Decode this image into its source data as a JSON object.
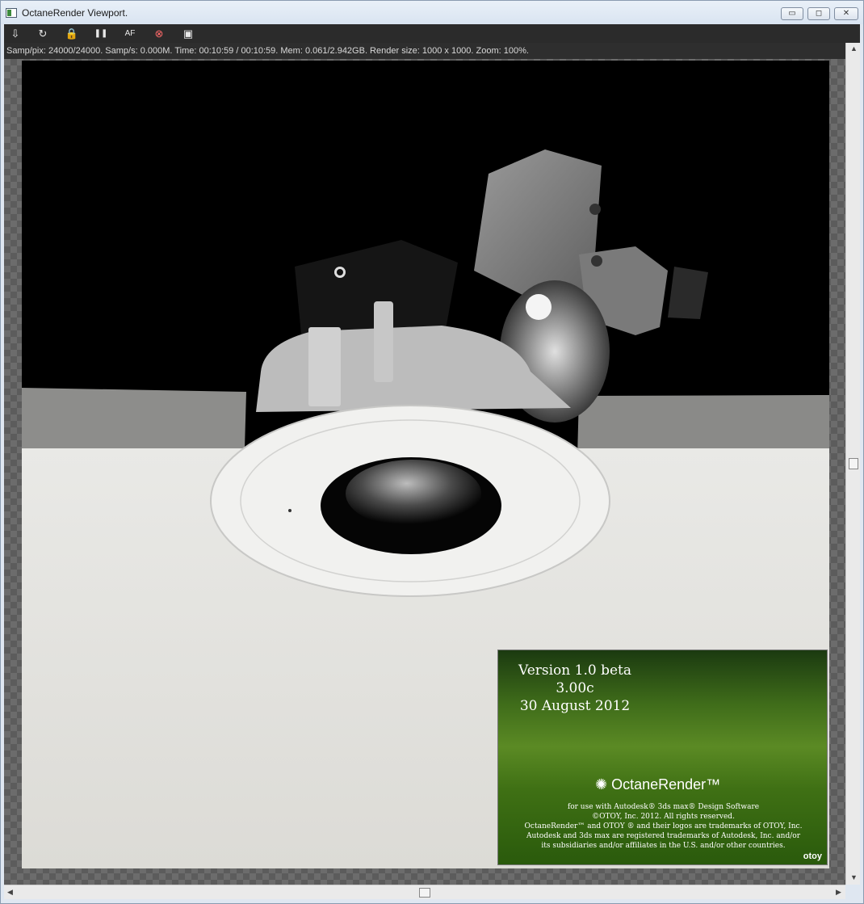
{
  "window": {
    "title": "OctaneRender Viewport.",
    "min_glyph": "▭",
    "max_glyph": "◻",
    "close_glyph": "✕"
  },
  "toolbar": {
    "items": [
      {
        "icon": "save-render-icon",
        "glyph": "⇩"
      },
      {
        "icon": "restart-render-icon",
        "glyph": "↻"
      },
      {
        "icon": "lock-icon",
        "glyph": "🔒"
      },
      {
        "icon": "pause-icon",
        "glyph": "❚❚"
      },
      {
        "icon": "focus-picker-icon",
        "glyph": "AF"
      },
      {
        "icon": "stop-render-icon",
        "glyph": "⊗"
      },
      {
        "icon": "display-icon",
        "glyph": "▣"
      }
    ]
  },
  "status": {
    "text": "Samp/pix: 24000/24000.   Samp/s: 0.000M.   Time: 00:10:59 / 00:10:59.   Mem: 0.061/2.942GB.   Render size: 1000 x 1000.   Zoom: 100%."
  },
  "splash": {
    "version_line1": "Version 1.0 beta 3.00c",
    "version_line2": "30 August 2012",
    "brand": "OctaneRender™",
    "legal_1": "for use with Autodesk® 3ds max® Design Software",
    "legal_2": "©OTOY, Inc. 2012. All rights reserved.",
    "legal_3": "OctaneRender™ and OTOY ® and their logos are trademarks of OTOY, Inc.",
    "legal_4": "Autodesk and 3ds max are registered trademarks of Autodesk, Inc. and/or",
    "legal_5": "its subsidiaries and/or affiliates in the U.S. and/or other countries.",
    "otoy": "otoy"
  },
  "scroll": {
    "up": "▲",
    "down": "▼",
    "left": "◀",
    "right": "▶"
  }
}
